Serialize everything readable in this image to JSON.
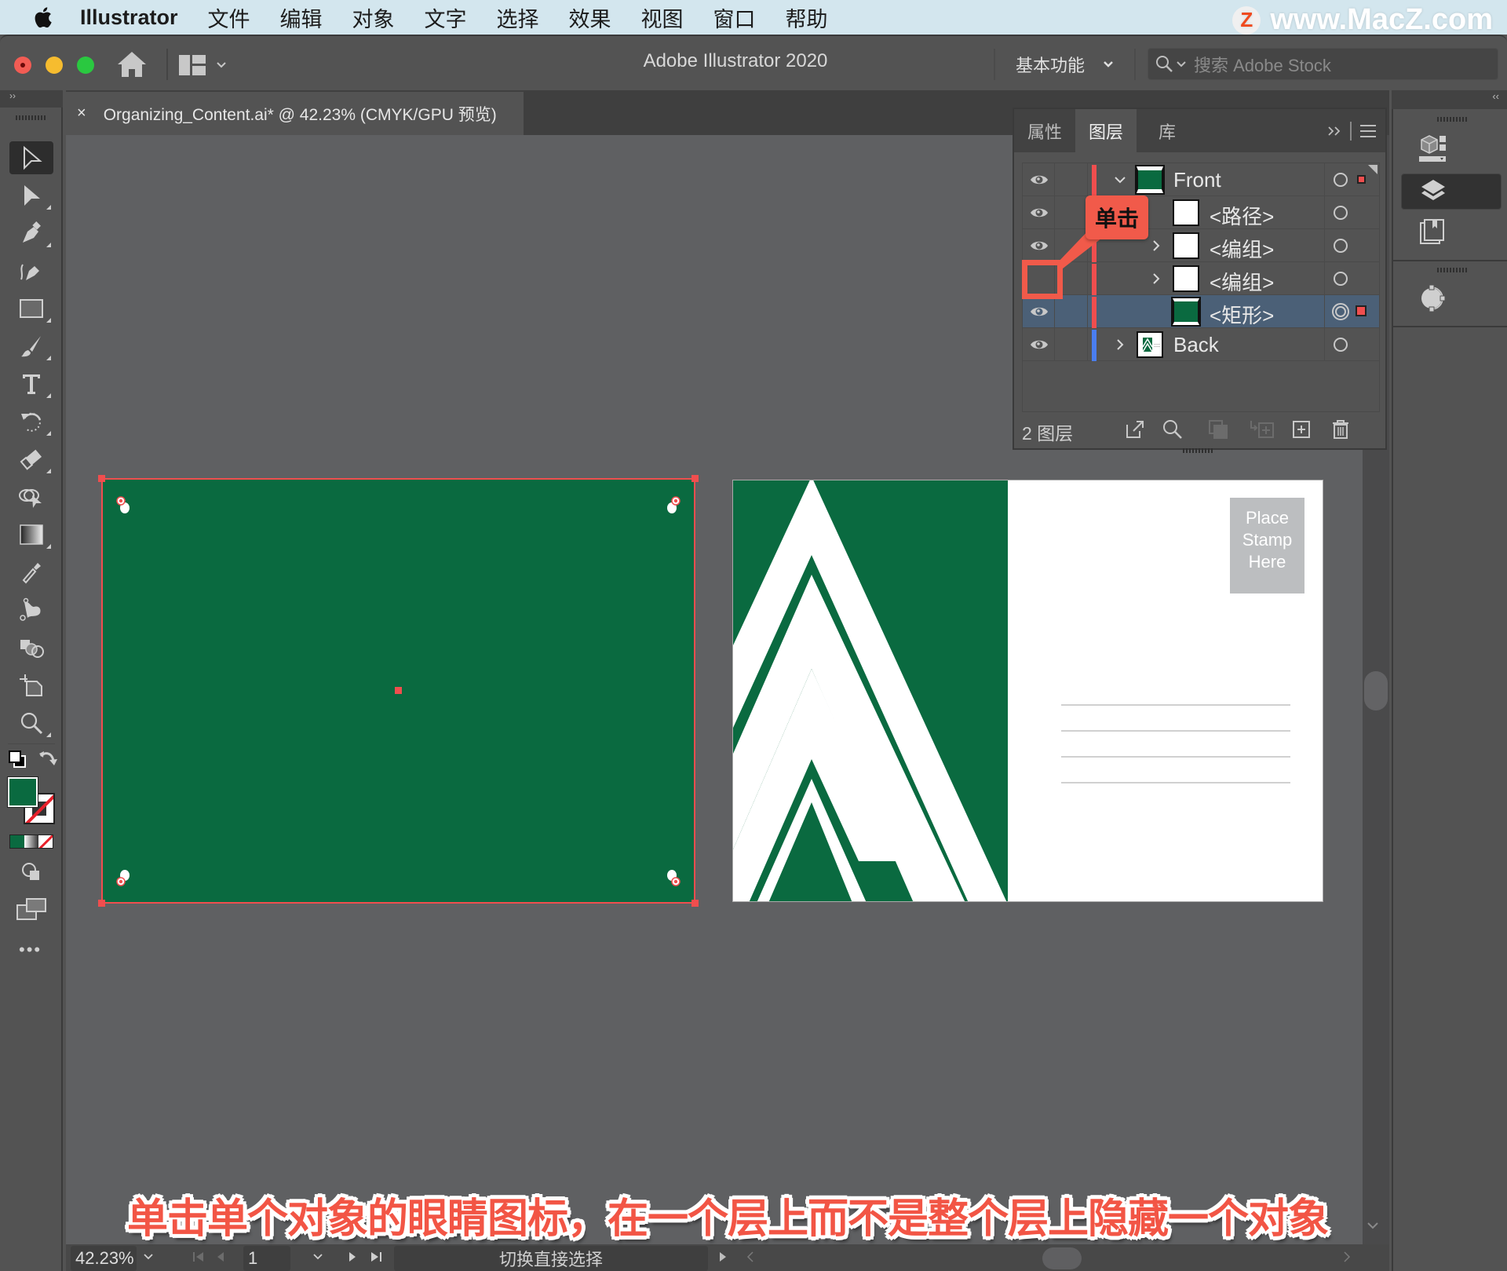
{
  "menubar": {
    "app_name": "Illustrator",
    "items": [
      "文件",
      "编辑",
      "对象",
      "文字",
      "选择",
      "效果",
      "视图",
      "窗口",
      "帮助"
    ],
    "watermark": "www.MacZ.com",
    "watermark_badge": "Z"
  },
  "titlebar": {
    "title": "Adobe Illustrator 2020",
    "workspace": "基本功能",
    "stock_search_placeholder": "搜索 Adobe Stock"
  },
  "document_tab": {
    "close": "×",
    "title": "Organizing_Content.ai* @ 42.23% (CMYK/GPU 预览)"
  },
  "toolbar": {
    "collapse": "››",
    "tools": [
      "selection-tool",
      "direct-selection-tool",
      "pen-tool",
      "curvature-tool",
      "rectangle-tool",
      "paintbrush-tool",
      "type-tool",
      "rotate-tool",
      "eraser-tool",
      "shape-builder-tool",
      "gradient-tool",
      "eyedropper-tool",
      "puppet-warp-tool",
      "blend-tool",
      "artboard-tool",
      "zoom-tool"
    ],
    "fill_color": "#0a6a40",
    "more": "•••"
  },
  "layers_panel": {
    "tabs": [
      "属性",
      "图层",
      "库"
    ],
    "active_tab": "图层",
    "rows": [
      {
        "name": "Front",
        "type": "layer",
        "visible": true,
        "expanded": true,
        "color": "#f04e4e",
        "selected_indicator": true
      },
      {
        "name": "<路径>",
        "type": "object",
        "visible": true,
        "color": "#f04e4e"
      },
      {
        "name": "<编组>",
        "type": "group",
        "visible": true,
        "color": "#f04e4e"
      },
      {
        "name": "<编组>",
        "type": "group",
        "visible": false,
        "color": "#f04e4e"
      },
      {
        "name": "<矩形>",
        "type": "object",
        "visible": true,
        "color": "#f04e4e",
        "active": true,
        "selected_indicator": true
      },
      {
        "name": "Back",
        "type": "layer",
        "visible": true,
        "expanded": false,
        "color": "#4a7ef0"
      }
    ],
    "layer_count": "2 图层",
    "callout": "单击"
  },
  "artboards": {
    "back_stamp": [
      "Place",
      "Stamp",
      "Here"
    ],
    "green": "#0a6a40"
  },
  "statusbar": {
    "zoom": "42.23%",
    "artboard_number": "1",
    "tool_status": "切换直接选择"
  },
  "caption": "单击单个对象的眼睛图标，在一个层上而不是整个层上隐藏一个对象"
}
